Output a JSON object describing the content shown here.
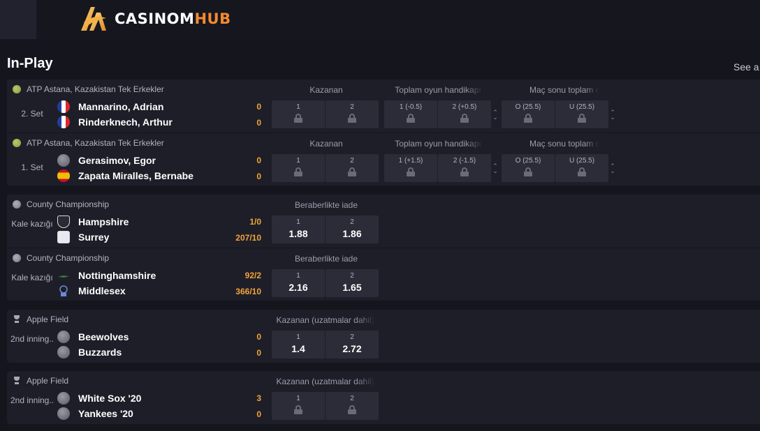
{
  "brand": {
    "part1": "CASINOM",
    "part2": "HUB"
  },
  "section": {
    "title": "In-Play",
    "see_all": "See a"
  },
  "events": [
    {
      "competition": "ATP Astana, Kazakistan Tek Erkekler",
      "period": "2. Set",
      "teams": [
        {
          "name": "Mannarino, Adrian",
          "score": "0",
          "flag": "france"
        },
        {
          "name": "Rinderknech, Arthur",
          "score": "0",
          "flag": "france"
        }
      ],
      "markets": [
        {
          "title": "Kazanan",
          "odds": [
            {
              "label": "1",
              "locked": true
            },
            {
              "label": "2",
              "locked": true
            }
          ]
        },
        {
          "title": "Toplam oyun handikapı",
          "odds": [
            {
              "label": "1 (-0.5)",
              "locked": true
            },
            {
              "label": "2 (+0.5)",
              "locked": true
            }
          ]
        },
        {
          "title": "Maç sonu toplam oyun",
          "odds": [
            {
              "label": "O (25.5)",
              "locked": true
            },
            {
              "label": "U (25.5)",
              "locked": true
            }
          ]
        }
      ]
    },
    {
      "competition": "ATP Astana, Kazakistan Tek Erkekler",
      "period": "1. Set",
      "teams": [
        {
          "name": "Gerasimov, Egor",
          "score": "0",
          "flag": "neutral"
        },
        {
          "name": "Zapata Miralles, Bernabe",
          "score": "0",
          "flag": "spain"
        }
      ],
      "markets": [
        {
          "title": "Kazanan",
          "odds": [
            {
              "label": "1",
              "locked": true
            },
            {
              "label": "2",
              "locked": true
            }
          ]
        },
        {
          "title": "Toplam oyun handikapı",
          "odds": [
            {
              "label": "1 (+1.5)",
              "locked": true
            },
            {
              "label": "2 (-1.5)",
              "locked": true
            }
          ]
        },
        {
          "title": "Maç sonu toplam oyun",
          "odds": [
            {
              "label": "O (25.5)",
              "locked": true
            },
            {
              "label": "U (25.5)",
              "locked": true
            }
          ]
        }
      ]
    },
    {
      "competition": "County Championship",
      "period": "Kale kazığı",
      "teams": [
        {
          "name": "Hampshire",
          "score": "1/0"
        },
        {
          "name": "Surrey",
          "score": "207/10"
        }
      ],
      "markets": [
        {
          "title": "Beraberlikte iade",
          "odds": [
            {
              "label": "1",
              "value": "1.88"
            },
            {
              "label": "2",
              "value": "1.86"
            }
          ]
        }
      ]
    },
    {
      "competition": "County Championship",
      "period": "Kale kazığı",
      "teams": [
        {
          "name": "Nottinghamshire",
          "score": "92/2"
        },
        {
          "name": "Middlesex",
          "score": "366/10"
        }
      ],
      "markets": [
        {
          "title": "Beraberlikte iade",
          "odds": [
            {
              "label": "1",
              "value": "2.16"
            },
            {
              "label": "2",
              "value": "1.65"
            }
          ]
        }
      ]
    },
    {
      "competition": "Apple Field",
      "period": "2nd inning..",
      "teams": [
        {
          "name": "Beewolves",
          "score": "0"
        },
        {
          "name": "Buzzards",
          "score": "0"
        }
      ],
      "markets": [
        {
          "title": "Kazanan (uzatmalar dahil)",
          "odds": [
            {
              "label": "1",
              "value": "1.4"
            },
            {
              "label": "2",
              "value": "2.72"
            }
          ]
        }
      ]
    },
    {
      "competition": "Apple Field",
      "period": "2nd inning..",
      "teams": [
        {
          "name": "White Sox '20",
          "score": "3"
        },
        {
          "name": "Yankees '20",
          "score": "0"
        }
      ],
      "markets": [
        {
          "title": "Kazanan (uzatmalar dahil)",
          "odds": [
            {
              "label": "1",
              "locked": true
            },
            {
              "label": "2",
              "locked": true
            }
          ]
        }
      ]
    }
  ]
}
